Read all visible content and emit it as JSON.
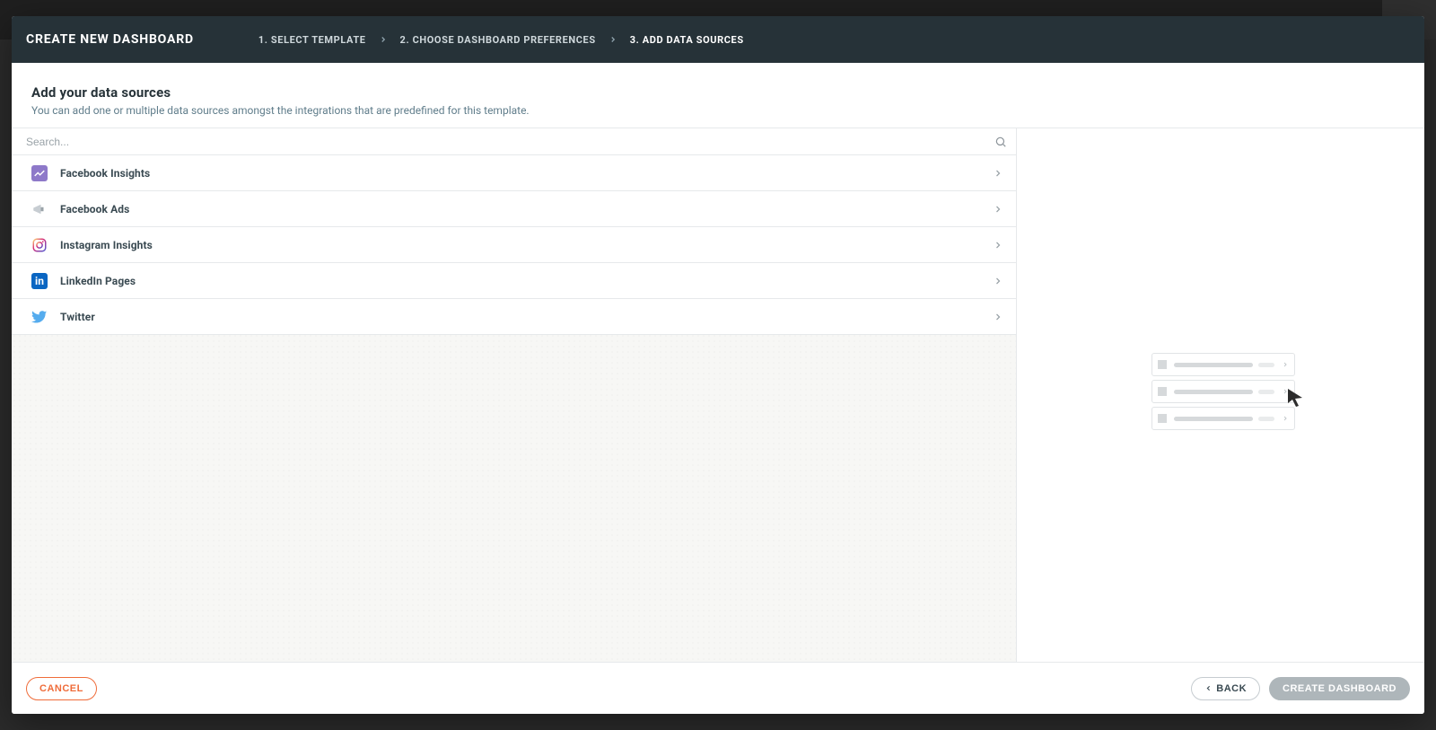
{
  "header": {
    "title": "CREATE NEW DASHBOARD",
    "steps": [
      {
        "label": "1. SELECT TEMPLATE",
        "active": false
      },
      {
        "label": "2. CHOOSE DASHBOARD PREFERENCES",
        "active": false
      },
      {
        "label": "3. ADD DATA SOURCES",
        "active": true
      }
    ]
  },
  "section": {
    "title": "Add your data sources",
    "sub": "You can add one or multiple data sources amongst the integrations that are predefined for this template."
  },
  "search": {
    "placeholder": "Search..."
  },
  "sources": [
    {
      "name": "Facebook Insights",
      "icon": "facebook-insights"
    },
    {
      "name": "Facebook Ads",
      "icon": "facebook-ads"
    },
    {
      "name": "Instagram Insights",
      "icon": "instagram"
    },
    {
      "name": "LinkedIn Pages",
      "icon": "linkedin"
    },
    {
      "name": "Twitter",
      "icon": "twitter"
    }
  ],
  "footer": {
    "cancel": "CANCEL",
    "back": "BACK",
    "create": "CREATE DASHBOARD"
  }
}
